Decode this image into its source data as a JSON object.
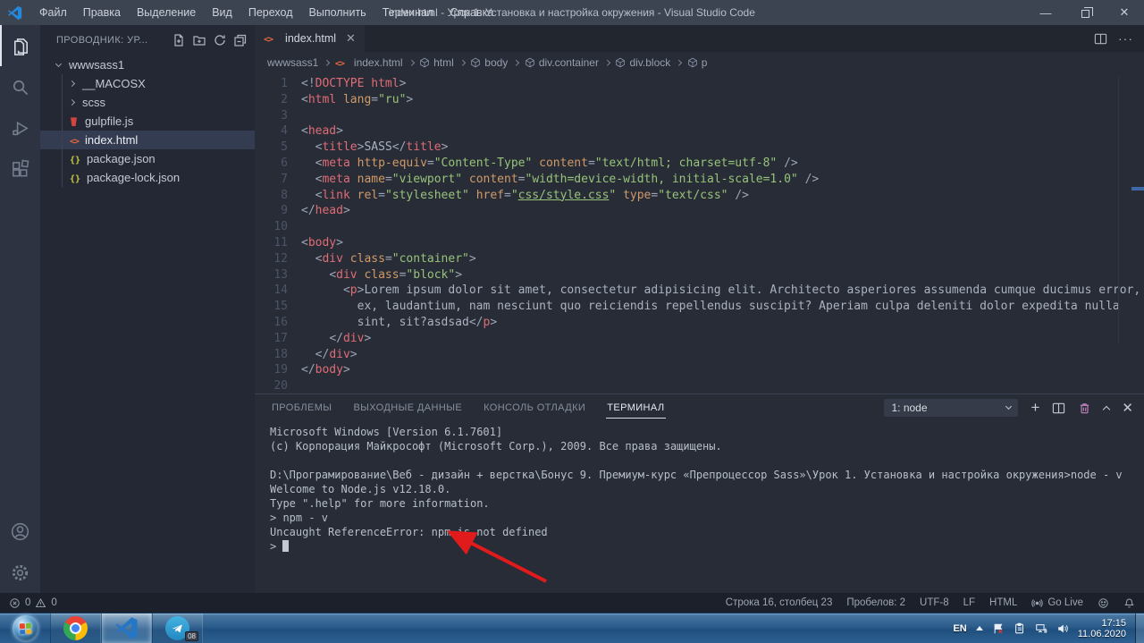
{
  "title_bar": {
    "menus": [
      "Файл",
      "Правка",
      "Выделение",
      "Вид",
      "Переход",
      "Выполнить",
      "Терминал",
      "Справка"
    ],
    "title": "index.html - Урок 1. Установка и настройка окружения - Visual Studio Code"
  },
  "sidebar": {
    "header": "ПРОВОДНИК: УР...",
    "root": "wwwsass1",
    "files": [
      {
        "name": "__MACOSX",
        "kind": "folder"
      },
      {
        "name": "scss",
        "kind": "folder"
      },
      {
        "name": "gulpfile.js",
        "kind": "gulp"
      },
      {
        "name": "index.html",
        "kind": "html",
        "selected": true
      },
      {
        "name": "package.json",
        "kind": "json"
      },
      {
        "name": "package-lock.json",
        "kind": "json"
      }
    ]
  },
  "editor": {
    "tab": "index.html",
    "breadcrumbs": [
      {
        "label": "wwwsass1",
        "icon": "none"
      },
      {
        "label": "index.html",
        "icon": "html"
      },
      {
        "label": "html",
        "icon": "cube"
      },
      {
        "label": "body",
        "icon": "cube"
      },
      {
        "label": "div.container",
        "icon": "cube"
      },
      {
        "label": "div.block",
        "icon": "cube"
      },
      {
        "label": "p",
        "icon": "cube"
      }
    ],
    "code_lines": [
      {
        "n": 1,
        "tokens": [
          [
            "pu",
            "<!"
          ],
          [
            "tag",
            "DOCTYPE html"
          ],
          [
            "pu",
            ">"
          ]
        ]
      },
      {
        "n": 2,
        "tokens": [
          [
            "pu",
            "<"
          ],
          [
            "tag",
            "html"
          ],
          [
            "txt",
            " "
          ],
          [
            "attr",
            "lang"
          ],
          [
            "pu",
            "="
          ],
          [
            "val",
            "\"ru\""
          ],
          [
            "pu",
            ">"
          ]
        ]
      },
      {
        "n": 3,
        "tokens": []
      },
      {
        "n": 4,
        "tokens": [
          [
            "pu",
            "<"
          ],
          [
            "tag",
            "head"
          ],
          [
            "pu",
            ">"
          ]
        ]
      },
      {
        "n": 5,
        "tokens": [
          [
            "txt",
            "  "
          ],
          [
            "pu",
            "<"
          ],
          [
            "tag",
            "title"
          ],
          [
            "pu",
            ">"
          ],
          [
            "txt",
            "SASS"
          ],
          [
            "pu",
            "</"
          ],
          [
            "tag",
            "title"
          ],
          [
            "pu",
            ">"
          ]
        ]
      },
      {
        "n": 6,
        "tokens": [
          [
            "txt",
            "  "
          ],
          [
            "pu",
            "<"
          ],
          [
            "tag",
            "meta"
          ],
          [
            "txt",
            " "
          ],
          [
            "attr",
            "http-equiv"
          ],
          [
            "pu",
            "="
          ],
          [
            "val",
            "\"Content-Type\""
          ],
          [
            "txt",
            " "
          ],
          [
            "attr",
            "content"
          ],
          [
            "pu",
            "="
          ],
          [
            "val",
            "\"text/html; charset=utf-8\""
          ],
          [
            "txt",
            " "
          ],
          [
            "pu",
            "/>"
          ]
        ]
      },
      {
        "n": 7,
        "tokens": [
          [
            "txt",
            "  "
          ],
          [
            "pu",
            "<"
          ],
          [
            "tag",
            "meta"
          ],
          [
            "txt",
            " "
          ],
          [
            "attr",
            "name"
          ],
          [
            "pu",
            "="
          ],
          [
            "val",
            "\"viewport\""
          ],
          [
            "txt",
            " "
          ],
          [
            "attr",
            "content"
          ],
          [
            "pu",
            "="
          ],
          [
            "val",
            "\"width=device-width, initial-scale=1.0\""
          ],
          [
            "txt",
            " "
          ],
          [
            "pu",
            "/>"
          ]
        ]
      },
      {
        "n": 8,
        "tokens": [
          [
            "txt",
            "  "
          ],
          [
            "pu",
            "<"
          ],
          [
            "tag",
            "link"
          ],
          [
            "txt",
            " "
          ],
          [
            "attr",
            "rel"
          ],
          [
            "pu",
            "="
          ],
          [
            "val",
            "\"stylesheet\""
          ],
          [
            "txt",
            " "
          ],
          [
            "attr",
            "href"
          ],
          [
            "pu",
            "="
          ],
          [
            "val",
            "\""
          ],
          [
            "lnk",
            "css/style.css"
          ],
          [
            "val",
            "\""
          ],
          [
            "txt",
            " "
          ],
          [
            "attr",
            "type"
          ],
          [
            "pu",
            "="
          ],
          [
            "val",
            "\"text/css\""
          ],
          [
            "txt",
            " "
          ],
          [
            "pu",
            "/>"
          ]
        ]
      },
      {
        "n": 9,
        "tokens": [
          [
            "pu",
            "</"
          ],
          [
            "tag",
            "head"
          ],
          [
            "pu",
            ">"
          ]
        ]
      },
      {
        "n": 10,
        "tokens": []
      },
      {
        "n": 11,
        "tokens": [
          [
            "pu",
            "<"
          ],
          [
            "tag",
            "body"
          ],
          [
            "pu",
            ">"
          ]
        ]
      },
      {
        "n": 12,
        "tokens": [
          [
            "txt",
            "  "
          ],
          [
            "pu",
            "<"
          ],
          [
            "tag",
            "div"
          ],
          [
            "txt",
            " "
          ],
          [
            "attr",
            "class"
          ],
          [
            "pu",
            "="
          ],
          [
            "val",
            "\"container\""
          ],
          [
            "pu",
            ">"
          ]
        ]
      },
      {
        "n": 13,
        "tokens": [
          [
            "txt",
            "    "
          ],
          [
            "pu",
            "<"
          ],
          [
            "tag",
            "div"
          ],
          [
            "txt",
            " "
          ],
          [
            "attr",
            "class"
          ],
          [
            "pu",
            "="
          ],
          [
            "val",
            "\"block\""
          ],
          [
            "pu",
            ">"
          ]
        ]
      },
      {
        "n": 14,
        "tokens": [
          [
            "txt",
            "      "
          ],
          [
            "pu",
            "<"
          ],
          [
            "tag",
            "p"
          ],
          [
            "pu",
            ">"
          ],
          [
            "txt",
            "Lorem ipsum dolor sit amet, consectetur adipisicing elit. Architecto asperiores assumenda cumque ducimus error,"
          ]
        ]
      },
      {
        "n": 15,
        "tokens": [
          [
            "txt",
            "        ex, laudantium, nam nesciunt quo reiciendis repellendus suscipit? Aperiam culpa deleniti dolor expedita nulla"
          ]
        ]
      },
      {
        "n": 16,
        "tokens": [
          [
            "txt",
            "        sint, sit?asdsad"
          ],
          [
            "pu",
            "</"
          ],
          [
            "tag",
            "p"
          ],
          [
            "pu",
            ">"
          ]
        ]
      },
      {
        "n": 17,
        "tokens": [
          [
            "txt",
            "    "
          ],
          [
            "pu",
            "</"
          ],
          [
            "tag",
            "div"
          ],
          [
            "pu",
            ">"
          ]
        ]
      },
      {
        "n": 18,
        "tokens": [
          [
            "txt",
            "  "
          ],
          [
            "pu",
            "</"
          ],
          [
            "tag",
            "div"
          ],
          [
            "pu",
            ">"
          ]
        ]
      },
      {
        "n": 19,
        "tokens": [
          [
            "pu",
            "</"
          ],
          [
            "tag",
            "body"
          ],
          [
            "pu",
            ">"
          ]
        ]
      },
      {
        "n": 20,
        "tokens": []
      }
    ]
  },
  "panel": {
    "tabs": [
      {
        "label": "ПРОБЛЕМЫ",
        "active": false
      },
      {
        "label": "ВЫХОДНЫЕ ДАННЫЕ",
        "active": false
      },
      {
        "label": "КОНСОЛЬ ОТЛАДКИ",
        "active": false
      },
      {
        "label": "ТЕРМИНАЛ",
        "active": true
      }
    ],
    "selector": "1: node",
    "terminal_lines": [
      "Microsoft Windows [Version 6.1.7601]",
      "(c) Корпорация Майкрософт (Microsoft Corp.), 2009. Все права защищены.",
      "",
      "D:\\Програмирование\\Веб - дизайн + верстка\\Бонус 9. Премиум-курс «Препроцессор Sass»\\Урок 1. Установка и настройка окружения>node - v",
      "Welcome to Node.js v12.18.0.",
      "Type \".help\" for more information.",
      "> npm - v",
      "Uncaught ReferenceError: npm is not defined",
      "> "
    ],
    "cursor_on_last_line": true
  },
  "status_bar": {
    "errors": "0",
    "warnings": "0",
    "line_col": "Строка 16, столбец 23",
    "spaces": "Пробелов: 2",
    "encoding": "UTF-8",
    "eol": "LF",
    "language": "HTML",
    "go_live": "Go Live"
  },
  "taskbar": {
    "language": "EN",
    "time": "17:15",
    "date": "11.06.2020",
    "telegram_badge": "08"
  },
  "colors": {
    "accent_blue": "#2489db",
    "annotation_arrow_red": "#e11b1b",
    "tag_red": "#e06c75",
    "attr_orange": "#d19a66",
    "string_green": "#98c379",
    "taskbar_blue": "#2b5c8b"
  }
}
